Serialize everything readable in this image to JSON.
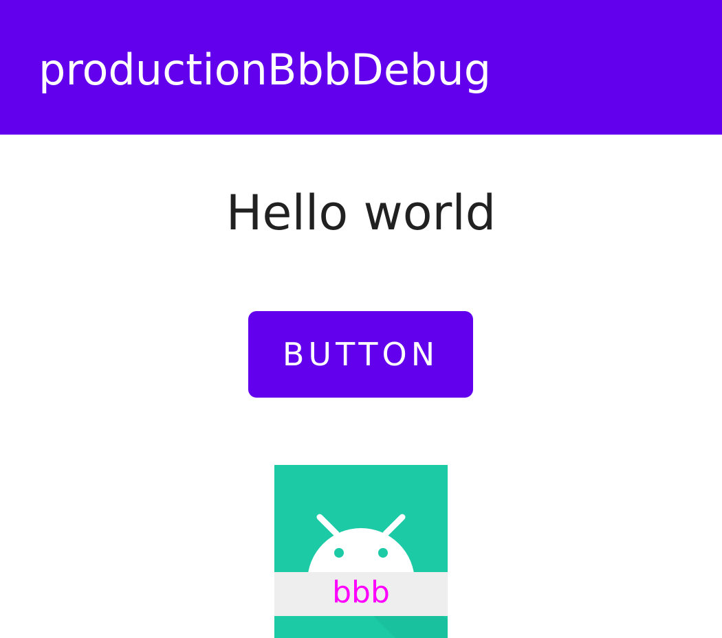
{
  "app_bar": {
    "title": "productionBbbDebug",
    "background_color": "#6200ee"
  },
  "main": {
    "hello_text": "Hello world",
    "button": {
      "label": "BUTTON",
      "background_color": "#6200ee"
    },
    "launcher_icon": {
      "icon": "android-robot-icon",
      "background_color": "#1ccba6",
      "banner_color": "#eeeeee",
      "flavor_label": "bbb",
      "flavor_label_color": "#ff00ff"
    }
  }
}
